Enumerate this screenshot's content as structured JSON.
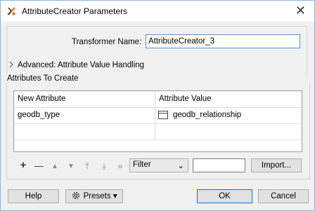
{
  "window": {
    "title": "AttributeCreator Parameters",
    "close_glyph": "✕"
  },
  "transformer": {
    "label": "Transformer Name:",
    "value": "AttributeCreator_3"
  },
  "advanced": {
    "label": "Advanced: Attribute Value Handling"
  },
  "attributes_group": {
    "title": "Attributes To Create"
  },
  "table": {
    "headers": [
      "New Attribute",
      "Attribute Value"
    ],
    "rows": [
      {
        "attribute": "geodb_type",
        "value": "geodb_relationship",
        "value_icon": "text-editor-icon"
      }
    ]
  },
  "toolbar": {
    "add": "+",
    "remove": "—",
    "up": "▲",
    "down": "▼",
    "top": "⤒",
    "bottom": "⤓",
    "more": "»",
    "filter_value": "Filter",
    "filter_chevron": "⌄",
    "filter_text": "",
    "import_label": "Import..."
  },
  "footer": {
    "help": "Help",
    "presets": "Presets",
    "presets_arrow": "▾",
    "ok": "OK",
    "cancel": "Cancel"
  }
}
